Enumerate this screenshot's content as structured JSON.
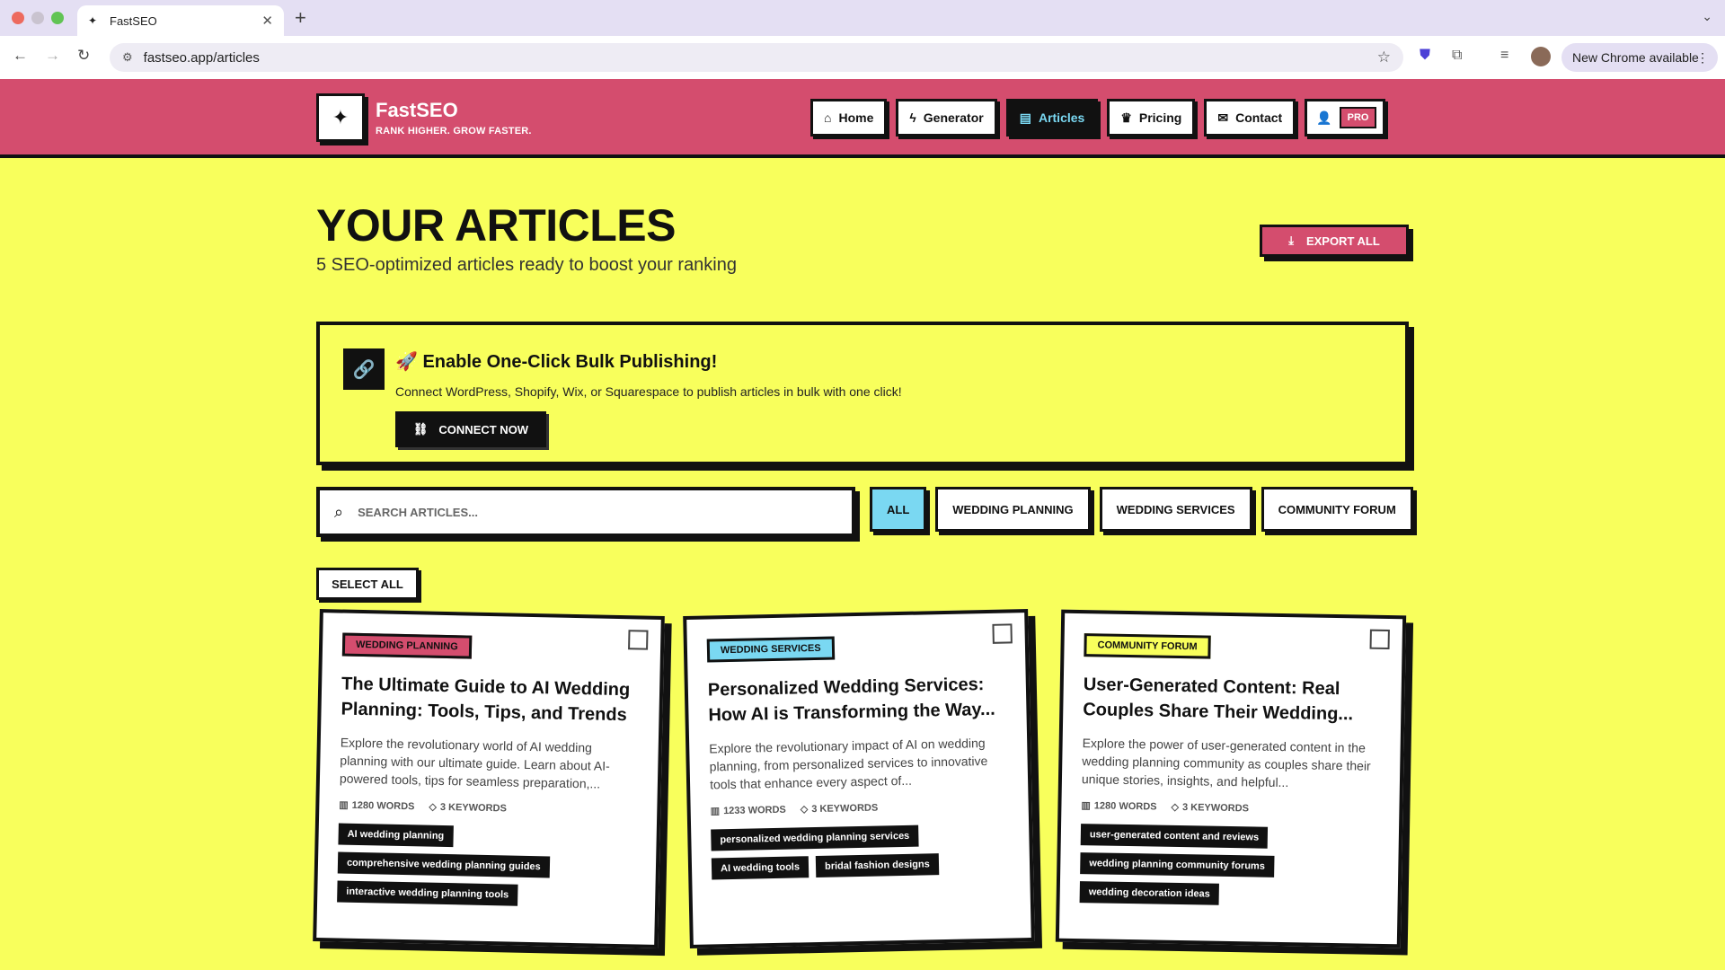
{
  "browser": {
    "tab_title": "FastSEO",
    "url": "fastseo.app/articles",
    "update_label": "New Chrome available"
  },
  "header": {
    "brand": "FastSEO",
    "tagline": "RANK HIGHER. GROW FASTER.",
    "nav": [
      {
        "label": "Home",
        "icon": "home-icon"
      },
      {
        "label": "Generator",
        "icon": "zap-icon"
      },
      {
        "label": "Articles",
        "icon": "document-icon",
        "active": true
      },
      {
        "label": "Pricing",
        "icon": "crown-icon"
      },
      {
        "label": "Contact",
        "icon": "mail-icon"
      }
    ],
    "pro_badge": "PRO"
  },
  "page": {
    "title": "YOUR ARTICLES",
    "subtitle": "5 SEO-optimized articles ready to boost your ranking",
    "export_label": "EXPORT ALL"
  },
  "promo": {
    "title": "🚀 Enable One-Click Bulk Publishing!",
    "text": "Connect WordPress, Shopify, Wix, or Squarespace to publish articles in bulk with one click!",
    "button": "CONNECT NOW"
  },
  "search": {
    "placeholder": "SEARCH ARTICLES..."
  },
  "filters": [
    "ALL",
    "WEDDING PLANNING",
    "WEDDING SERVICES",
    "COMMUNITY FORUM"
  ],
  "select_all": "SELECT ALL",
  "articles": [
    {
      "category": "WEDDING PLANNING",
      "category_color": "#d44d6e",
      "title": "The Ultimate Guide to AI Wedding Planning: Tools, Tips, and Trends",
      "description": "Explore the revolutionary world of AI wedding planning with our ultimate guide. Learn about AI-powered tools, tips for seamless preparation,...",
      "words": "1280 WORDS",
      "keywords_count": "3 KEYWORDS",
      "keywords": [
        "AI wedding planning",
        "comprehensive wedding planning guides",
        "interactive wedding planning tools"
      ]
    },
    {
      "category": "WEDDING SERVICES",
      "category_color": "#7ad8f2",
      "title": "Personalized Wedding Services: How AI is Transforming the Way...",
      "description": "Explore the revolutionary impact of AI on wedding planning, from personalized services to innovative tools that enhance every aspect of...",
      "words": "1233 WORDS",
      "keywords_count": "3 KEYWORDS",
      "keywords": [
        "personalized wedding planning services",
        "AI wedding tools",
        "bridal fashion designs"
      ]
    },
    {
      "category": "COMMUNITY FORUM",
      "category_color": "#f8ff5c",
      "title": "User-Generated Content: Real Couples Share Their Wedding...",
      "description": "Explore the power of user-generated content in the wedding planning community as couples share their unique stories, insights, and helpful...",
      "words": "1280 WORDS",
      "keywords_count": "3 KEYWORDS",
      "keywords": [
        "user-generated content and reviews",
        "wedding planning community forums",
        "wedding decoration ideas"
      ]
    }
  ]
}
